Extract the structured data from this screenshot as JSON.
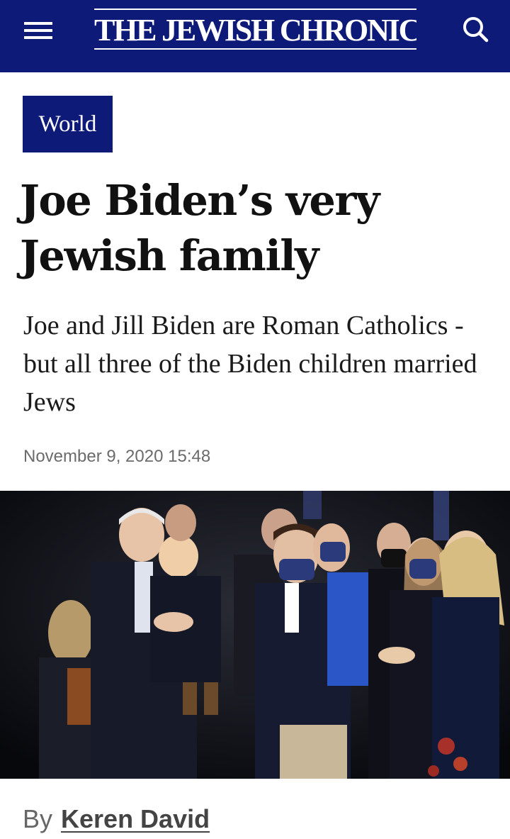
{
  "header": {
    "masthead": "THE JEWISH CHRONICLE",
    "menu_icon": "hamburger-menu-icon",
    "search_icon": "search-icon",
    "background_color": "#0e1a78"
  },
  "article": {
    "category": "World",
    "headline": "Joe Biden’s very Jewish family",
    "standfirst": "Joe and Jill Biden are Roman Catholics - but all three of the Biden children married Jews",
    "date": "November 9, 2020 15:48",
    "byline_prefix": "By",
    "author": "Keren David"
  },
  "colors": {
    "brand_navy": "#0e1a78",
    "text": "#111111",
    "meta_text": "#6b6b6b"
  }
}
